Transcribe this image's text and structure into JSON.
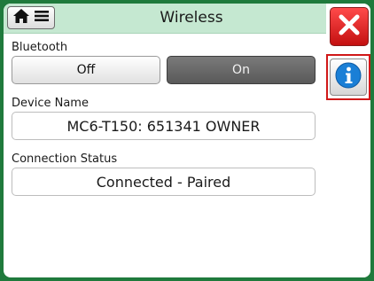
{
  "header": {
    "title": "Wireless",
    "home_icon": "home-icon",
    "menu_icon": "hamburger-menu-icon"
  },
  "side": {
    "close_icon": "close-x-icon",
    "info_icon": "info-icon"
  },
  "bluetooth": {
    "label": "Bluetooth",
    "off_label": "Off",
    "on_label": "On",
    "selected": "On"
  },
  "device": {
    "label": "Device Name",
    "value": "MC6-T150: 651341 OWNER"
  },
  "connection": {
    "label": "Connection Status",
    "value": "Connected - Paired"
  },
  "colors": {
    "border_green": "#1f7a3c",
    "titlebar": "#c5e8d1",
    "close_red": "#d01818",
    "info_blue": "#1a7fd6"
  }
}
